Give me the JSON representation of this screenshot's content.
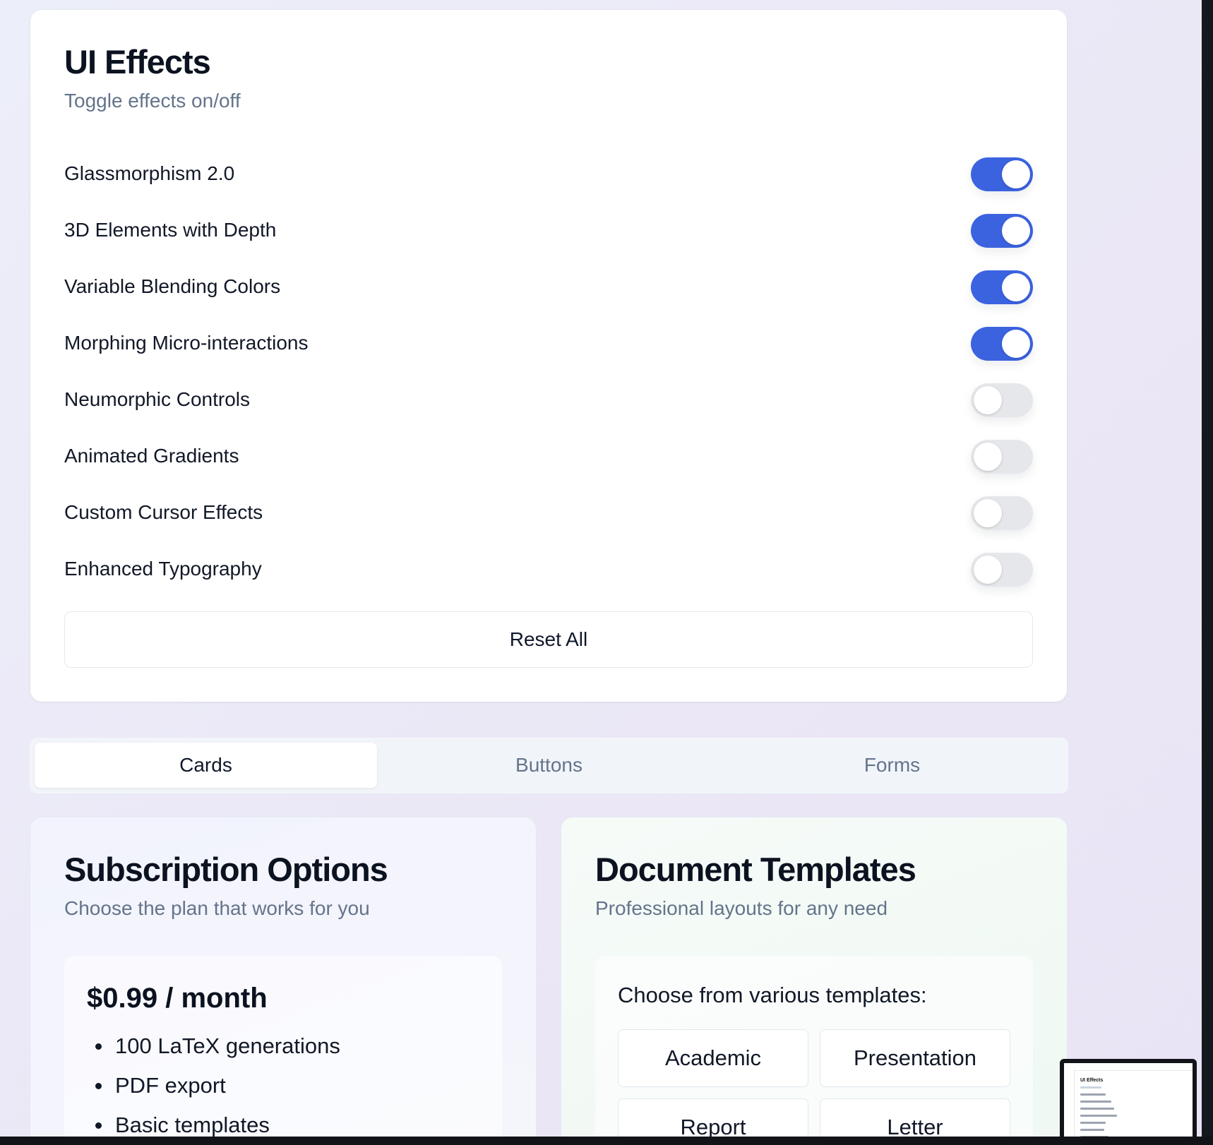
{
  "effects": {
    "title": "UI Effects",
    "subtitle": "Toggle effects on/off",
    "items": [
      {
        "label": "Glassmorphism 2.0",
        "on": true
      },
      {
        "label": "3D Elements with Depth",
        "on": true
      },
      {
        "label": "Variable Blending Colors",
        "on": true
      },
      {
        "label": "Morphing Micro-interactions",
        "on": true
      },
      {
        "label": "Neumorphic Controls",
        "on": false
      },
      {
        "label": "Animated Gradients",
        "on": false
      },
      {
        "label": "Custom Cursor Effects",
        "on": false
      },
      {
        "label": "Enhanced Typography",
        "on": false
      }
    ],
    "reset_label": "Reset All"
  },
  "tabs": [
    {
      "label": "Cards",
      "active": true
    },
    {
      "label": "Buttons",
      "active": false
    },
    {
      "label": "Forms",
      "active": false
    }
  ],
  "subscription": {
    "title": "Subscription Options",
    "subtitle": "Choose the plan that works for you",
    "price": "$0.99 / month",
    "features": [
      "100 LaTeX generations",
      "PDF export",
      "Basic templates"
    ]
  },
  "documents": {
    "title": "Document Templates",
    "subtitle": "Professional layouts for any need",
    "intro": "Choose from various templates:",
    "templates": [
      "Academic",
      "Presentation",
      "Report",
      "Letter"
    ]
  },
  "mini_preview": {
    "title": "UI Effects"
  },
  "colors": {
    "toggle_on": "#3b63e0",
    "toggle_off": "#e5e7eb"
  }
}
